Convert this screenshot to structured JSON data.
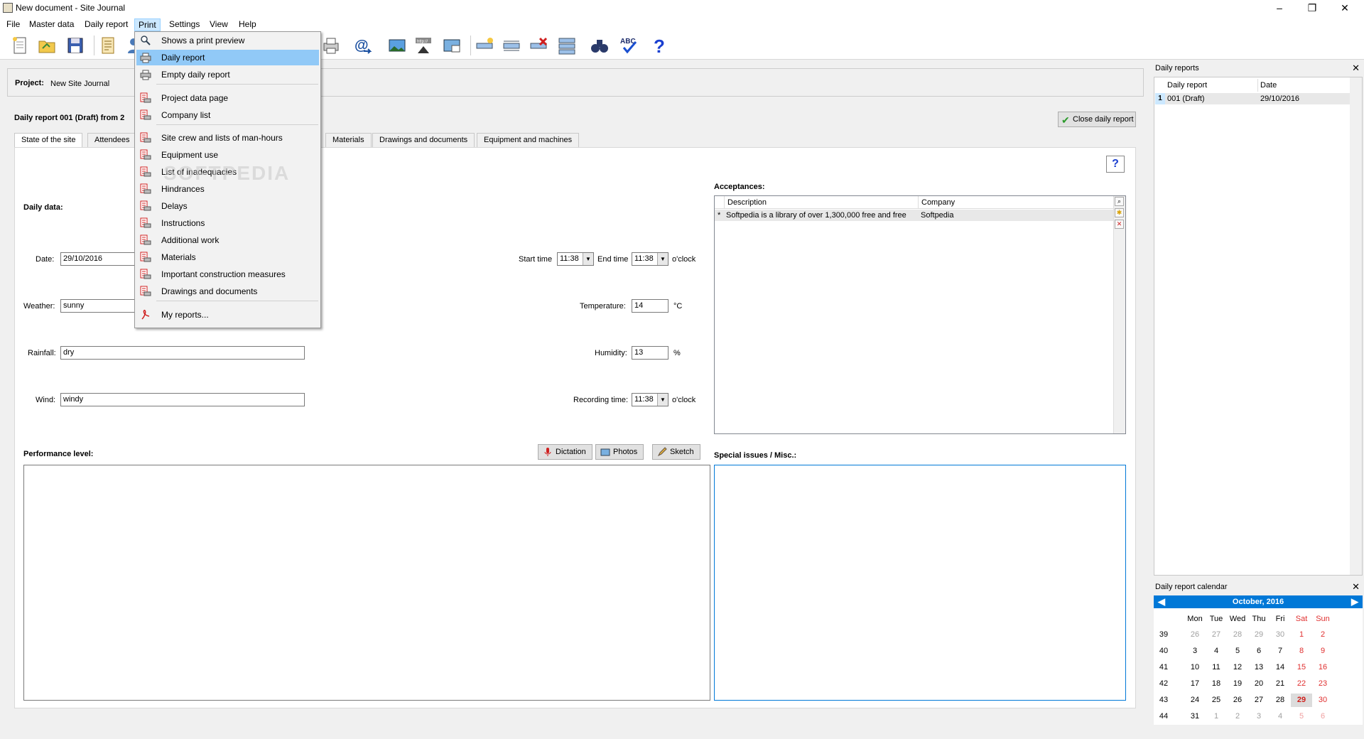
{
  "window": {
    "title": "New document - Site Journal",
    "minimize": "–",
    "maximize": "❐",
    "close": "✕"
  },
  "menubar": [
    "File",
    "Master data",
    "Daily report",
    "Print",
    "Settings",
    "View",
    "Help"
  ],
  "print_menu": {
    "items": [
      {
        "label": "Shows a print preview",
        "icon": "magnifier-icon"
      },
      {
        "label": "Daily report",
        "icon": "printer-icon",
        "highlighted": true
      },
      {
        "label": "Empty daily report",
        "icon": "printer-icon"
      },
      {
        "label": "Project data page",
        "icon": "report-printer-icon"
      },
      {
        "label": "Company list",
        "icon": "report-printer-icon"
      },
      {
        "label": "Site crew and lists of man-hours",
        "icon": "report-printer-icon"
      },
      {
        "label": "Equipment use",
        "icon": "report-printer-icon"
      },
      {
        "label": "List of inadequacies",
        "icon": "report-printer-icon"
      },
      {
        "label": "Hindrances",
        "icon": "report-printer-icon"
      },
      {
        "label": "Delays",
        "icon": "report-printer-icon"
      },
      {
        "label": "Instructions",
        "icon": "report-printer-icon"
      },
      {
        "label": "Additional work",
        "icon": "report-printer-icon"
      },
      {
        "label": "Materials",
        "icon": "report-printer-icon"
      },
      {
        "label": "Important construction measures",
        "icon": "report-printer-icon"
      },
      {
        "label": "Drawings and documents",
        "icon": "report-printer-icon"
      },
      {
        "label": "My reports...",
        "icon": "pdf-icon"
      }
    ]
  },
  "watermark": "SOFTPEDIA",
  "project": {
    "label": "Project:",
    "value": "New Site Journal"
  },
  "report_heading": "Daily report 001 (Draft) from 2",
  "close_daily_report": "Close daily report",
  "tabs": [
    "State of the site",
    "Attendees",
    "Materials",
    "Drawings and documents",
    "Equipment and machines"
  ],
  "daily_data": {
    "heading": "Daily data:",
    "date_label": "Date:",
    "date_value": "29/10/2016",
    "weather_label": "Weather:",
    "weather_value": "sunny",
    "rainfall_label": "Rainfall:",
    "rainfall_value": "dry",
    "wind_label": "Wind:",
    "wind_value": "windy",
    "start_time_label": "Start time",
    "start_time": "11:38",
    "end_time_label": "End time",
    "end_time": "11:38",
    "oclock": "o'clock",
    "temperature_label": "Temperature:",
    "temperature": "14",
    "temperature_unit": "°C",
    "humidity_label": "Humidity:",
    "humidity": "13",
    "humidity_unit": "%",
    "recording_time_label": "Recording time:",
    "recording_time": "11:38"
  },
  "acceptances": {
    "heading": "Acceptances:",
    "columns": [
      "Description",
      "Company"
    ],
    "rows": [
      {
        "marker": "*",
        "description": "Softpedia is a library of over 1,300,000 free and free",
        "company": "Softpedia"
      }
    ]
  },
  "performance": {
    "heading": "Performance level:",
    "dictation": "Dictation",
    "photos": "Photos",
    "sketch": "Sketch"
  },
  "special": {
    "heading": "Special issues / Misc.:"
  },
  "help_label": "?",
  "daily_reports_panel": {
    "title": "Daily reports",
    "columns": [
      "Daily report",
      "Date"
    ],
    "rows": [
      {
        "num": "1",
        "report": "001 (Draft)",
        "date": "29/10/2016"
      }
    ]
  },
  "calendar": {
    "title": "Daily report calendar",
    "month": "October,  2016",
    "weekdays": [
      "Mon",
      "Tue",
      "Wed",
      "Thu",
      "Fri",
      "Sat",
      "Sun"
    ],
    "weeks": [
      {
        "wk": "39",
        "days": [
          "26",
          "27",
          "28",
          "29",
          "30",
          "1",
          "2"
        ]
      },
      {
        "wk": "40",
        "days": [
          "3",
          "4",
          "5",
          "6",
          "7",
          "8",
          "9"
        ]
      },
      {
        "wk": "41",
        "days": [
          "10",
          "11",
          "12",
          "13",
          "14",
          "15",
          "16"
        ]
      },
      {
        "wk": "42",
        "days": [
          "17",
          "18",
          "19",
          "20",
          "21",
          "22",
          "23"
        ]
      },
      {
        "wk": "43",
        "days": [
          "24",
          "25",
          "26",
          "27",
          "28",
          "29",
          "30"
        ]
      },
      {
        "wk": "44",
        "days": [
          "31",
          "1",
          "2",
          "3",
          "4",
          "5",
          "6"
        ]
      }
    ],
    "selected_day": "29",
    "accent": "#0078d7"
  }
}
